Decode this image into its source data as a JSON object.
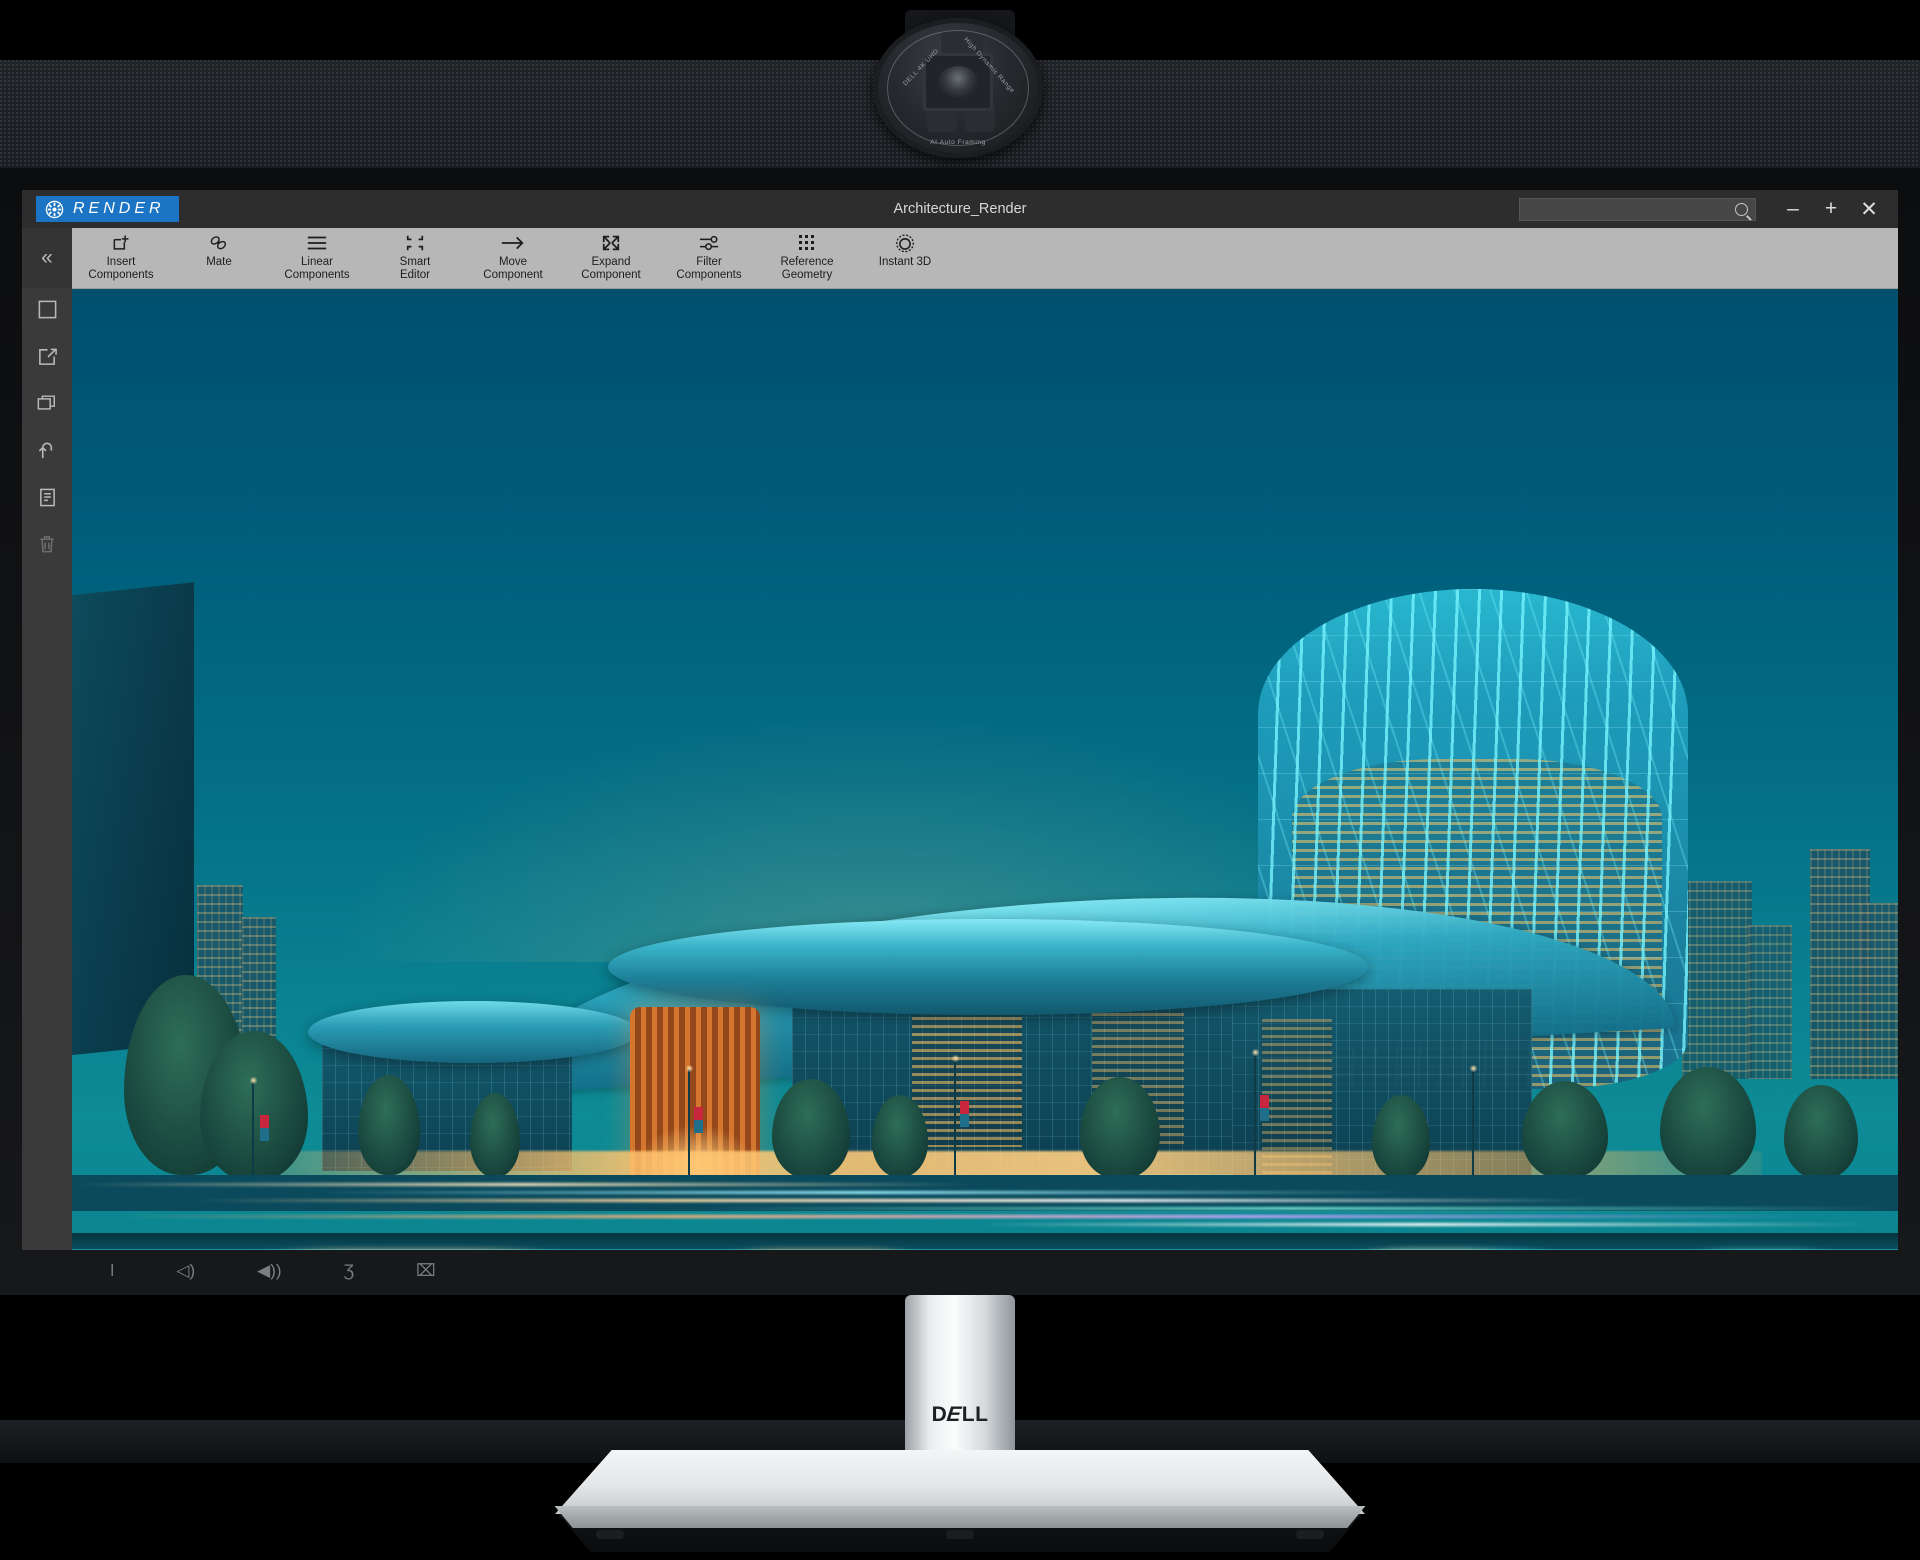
{
  "device": {
    "brand": "DELL",
    "webcam": {
      "label_left": "DELL   4K UHD",
      "label_right": "High Dynamic Range",
      "label_bottom": "AI Auto Framing"
    },
    "osd_buttons": [
      {
        "name": "joystick-button",
        "glyph": "ǀ"
      },
      {
        "name": "volume-down-button",
        "glyph": "◁)"
      },
      {
        "name": "volume-up-button",
        "glyph": "◀))"
      },
      {
        "name": "microphone-mute-button",
        "glyph": "Ʒ"
      },
      {
        "name": "camera-off-button",
        "glyph": "⌧"
      }
    ]
  },
  "app": {
    "brand_name": "RENDER",
    "window_title": "Architecture_Render",
    "search": {
      "value": "",
      "placeholder": ""
    },
    "window_controls": [
      {
        "name": "minimize-button",
        "glyph": "–"
      },
      {
        "name": "maximize-button",
        "glyph": "+"
      },
      {
        "name": "close-button",
        "glyph": "✕"
      }
    ],
    "sidebar": {
      "collapse_glyph": "«",
      "items": [
        {
          "name": "sidebar-item-select",
          "icon": "square-icon"
        },
        {
          "name": "sidebar-item-edit",
          "icon": "edit-box-icon"
        },
        {
          "name": "sidebar-item-duplicate",
          "icon": "copy-layers-icon"
        },
        {
          "name": "sidebar-item-undo",
          "icon": "undo-arrow-icon"
        },
        {
          "name": "sidebar-item-document",
          "icon": "document-icon"
        },
        {
          "name": "sidebar-item-delete",
          "icon": "trash-icon"
        }
      ]
    },
    "toolbar": [
      {
        "name": "tool-insert-components",
        "label": "Insert\nComponents",
        "icon": "insert-component-icon"
      },
      {
        "name": "tool-mate",
        "label": "Mate",
        "icon": "chain-link-icon"
      },
      {
        "name": "tool-linear-components",
        "label": "Linear\nComponents",
        "icon": "hamburger-lines-icon"
      },
      {
        "name": "tool-smart-editor",
        "label": "Smart\nEditor",
        "icon": "crop-corners-icon"
      },
      {
        "name": "tool-move-component",
        "label": "Move\nComponent",
        "icon": "right-arrow-icon"
      },
      {
        "name": "tool-expand-component",
        "label": "Expand\nComponent",
        "icon": "expand-arrows-icon"
      },
      {
        "name": "tool-filter-components",
        "label": "Filter\nComponents",
        "icon": "sliders-icon"
      },
      {
        "name": "tool-reference-geometry",
        "label": "Reference\nGeometry",
        "icon": "dot-grid-icon"
      },
      {
        "name": "tool-instant-3d",
        "label": "Instant 3D",
        "icon": "sun-dial-icon"
      }
    ]
  },
  "render_scene": {
    "description": "Night architectural visualization of a modern convention centre with sweeping elliptical canopy roof, curved glass tower with vertical teal fins, copper louvred drum, reflecting pool and motion-blurred traffic light trails",
    "time_of_day": "blue hour / twilight",
    "palette": {
      "sky_top": "#004f6e",
      "sky_bottom": "#0d8b96",
      "water": "#0f95a2",
      "glass_teal": "#1e9cbb",
      "fin_highlight": "#78f5ff",
      "interior_warm": "#ffba5c",
      "copper": "#d4762e",
      "foliage": "#2e6e58"
    }
  },
  "theme": {
    "accent_blue": "#1c74c4",
    "titlebar_bg": "#2d2d2d",
    "ribbon_bg": "#b7b7b7",
    "sidebar_bg": "#3a3a3a"
  }
}
